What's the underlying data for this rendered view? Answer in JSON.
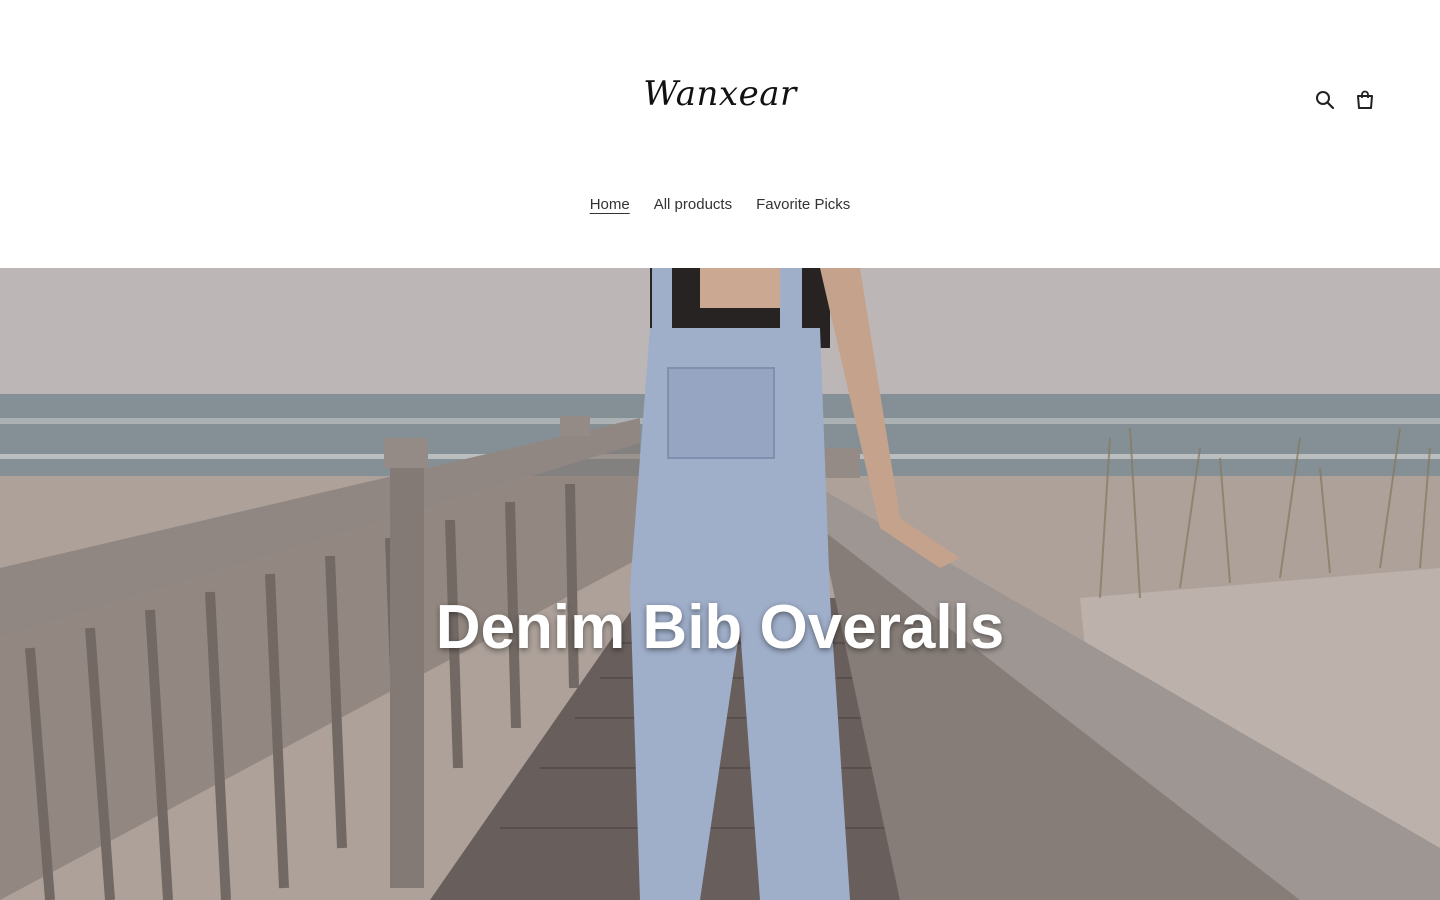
{
  "header": {
    "logo_text": "Wanxear",
    "icons": [
      "search-icon",
      "cart-icon"
    ]
  },
  "nav": {
    "items": [
      {
        "label": "Home",
        "active": true
      },
      {
        "label": "All products",
        "active": false
      },
      {
        "label": "Favorite Picks",
        "active": false
      }
    ]
  },
  "hero": {
    "title": "Denim Bib Overalls"
  },
  "colors": {
    "text": "#333333",
    "background": "#ffffff",
    "sky": "#c9c2c3",
    "sea": "#8e9aa0",
    "sand": "#b8aca4",
    "wood": "#8a7f79",
    "denim": "#a9b9d6"
  }
}
